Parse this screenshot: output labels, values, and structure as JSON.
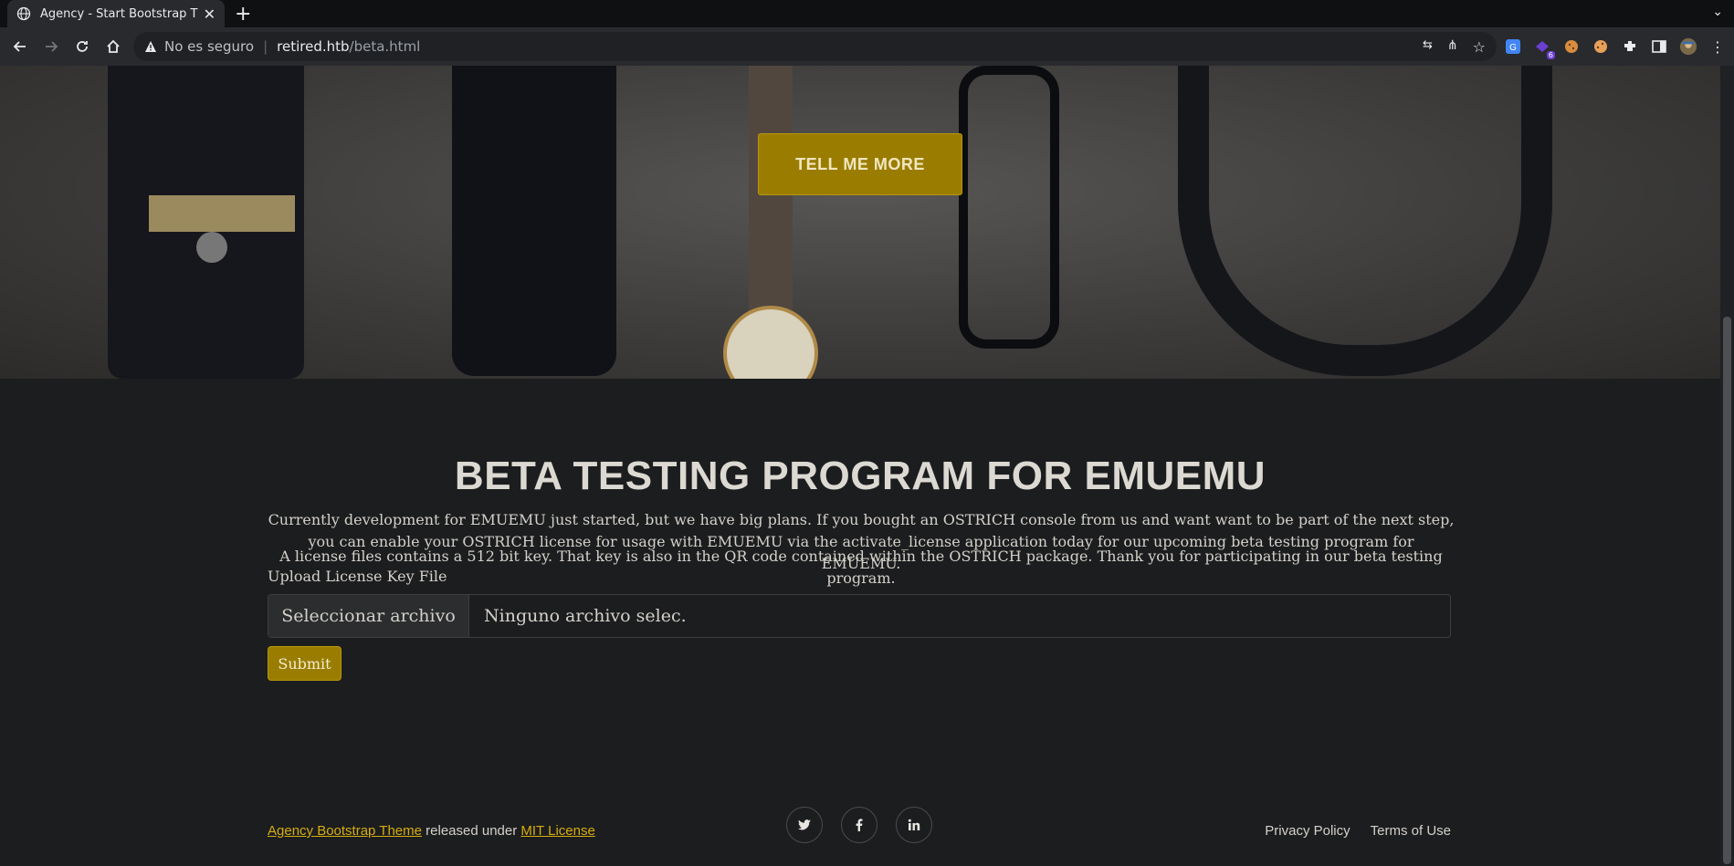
{
  "browser": {
    "tab_title": "Agency - Start Bootstrap Theme",
    "tab_close": "✕",
    "new_tab": "+",
    "tab_menu": "⌄",
    "omnibox": {
      "security_label": "No es seguro",
      "host": "retired.htb",
      "path": "/beta.html"
    },
    "extension_badge": "6"
  },
  "hero": {
    "button_label": "TELL ME MORE",
    "accent": "#9a7d00"
  },
  "main": {
    "heading": "BETA TESTING PROGRAM FOR EMUEMU",
    "paragraph1": "Currently development for EMUEMU just started, but we have big plans. If you bought an OSTRICH console from us and want want to be part of the next step, you can enable your OSTRICH license for usage with EMUEMU via the activate_license application today for our upcoming beta testing program for EMUEMU.",
    "paragraph2": "A license files contains a 512 bit key. That key is also in the QR code contained within the OSTRICH package. Thank you for participating in our beta testing program.",
    "upload_label": "Upload License Key File",
    "file_button": "Seleccionar archivo",
    "file_status": "Ninguno archivo selec.",
    "submit_label": "Submit"
  },
  "footer": {
    "theme_link": "Agency Bootstrap Theme",
    "released_text": " released under ",
    "license_link": "MIT License",
    "social": [
      "twitter-icon",
      "facebook-icon",
      "linkedin-icon"
    ],
    "privacy": "Privacy Policy",
    "terms": "Terms of Use"
  }
}
